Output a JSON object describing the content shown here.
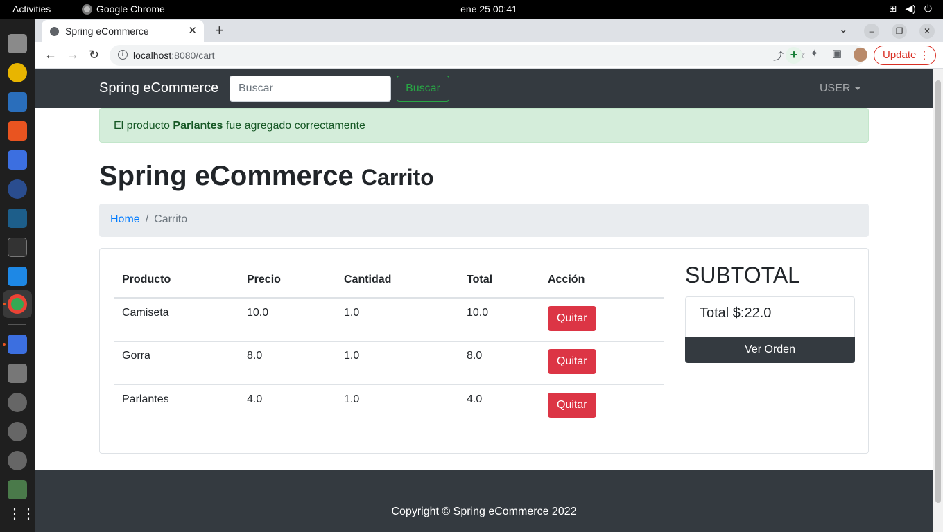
{
  "os": {
    "activities": "Activities",
    "app_name": "Google Chrome",
    "clock": "ene 25  00:41"
  },
  "browser": {
    "tab_title": "Spring eCommerce",
    "url_host": "localhost",
    "url_rest": ":8080/cart",
    "update_label": "Update"
  },
  "navbar": {
    "brand": "Spring eCommerce",
    "search_placeholder": "Buscar",
    "search_button": "Buscar",
    "user_menu": "USER"
  },
  "alert": {
    "prefix": "El producto",
    "product": "Parlantes",
    "suffix": "fue agregado correctamente"
  },
  "page": {
    "title": "Spring eCommerce",
    "subtitle": "Carrito"
  },
  "breadcrumb": {
    "home": "Home",
    "separator": "/",
    "current": "Carrito"
  },
  "cart": {
    "headers": [
      "Producto",
      "Precio",
      "Cantidad",
      "Total",
      "Acción"
    ],
    "rows": [
      {
        "producto": "Camiseta",
        "precio": "10.0",
        "cantidad": "1.0",
        "total": "10.0",
        "accion": "Quitar"
      },
      {
        "producto": "Gorra",
        "precio": "8.0",
        "cantidad": "1.0",
        "total": "8.0",
        "accion": "Quitar"
      },
      {
        "producto": "Parlantes",
        "precio": "4.0",
        "cantidad": "1.0",
        "total": "4.0",
        "accion": "Quitar"
      }
    ]
  },
  "subtotal": {
    "heading": "SUBTOTAL",
    "total_text": "Total $:22.0",
    "order_button": "Ver Orden"
  },
  "footer": {
    "copyright": "Copyright © Spring eCommerce 2022"
  },
  "colors": {
    "navbar_bg": "#343a40",
    "success": "#28a745",
    "danger": "#dc3545",
    "link": "#007bff",
    "alert_bg": "#d4edda"
  }
}
